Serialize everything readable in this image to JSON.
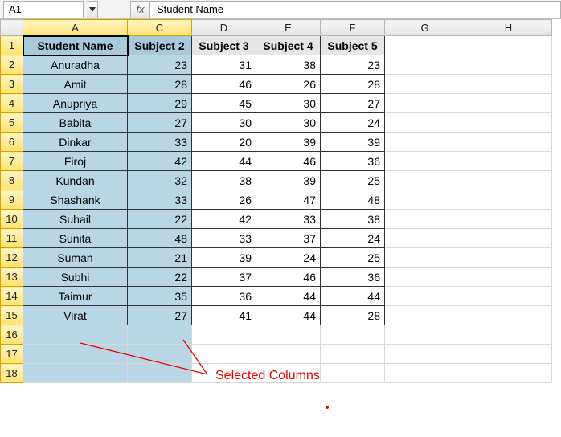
{
  "namebox": {
    "value": "A1"
  },
  "formula_bar": {
    "fx_label": "fx",
    "value": "Student Name"
  },
  "columns": [
    "A",
    "C",
    "D",
    "E",
    "F",
    "G",
    "H"
  ],
  "selected_columns": [
    "A",
    "C"
  ],
  "row_count": 18,
  "selected_row_max": 18,
  "headers": {
    "A": "Student Name",
    "C": "Subject 2",
    "D": "Subject 3",
    "E": "Subject 4",
    "F": "Subject 5"
  },
  "chart_data": {
    "type": "table",
    "title": "",
    "columns": [
      "Student Name",
      "Subject 2",
      "Subject 3",
      "Subject 4",
      "Subject 5"
    ],
    "rows": [
      [
        "Anuradha",
        23,
        31,
        38,
        23
      ],
      [
        "Amit",
        28,
        46,
        26,
        28
      ],
      [
        "Anupriya",
        29,
        45,
        30,
        27
      ],
      [
        "Babita",
        27,
        30,
        30,
        24
      ],
      [
        "Dinkar",
        33,
        20,
        39,
        39
      ],
      [
        "Firoj",
        42,
        44,
        46,
        36
      ],
      [
        "Kundan",
        32,
        38,
        39,
        25
      ],
      [
        "Shashank",
        33,
        26,
        47,
        48
      ],
      [
        "Suhail",
        22,
        42,
        33,
        38
      ],
      [
        "Sunita",
        48,
        33,
        37,
        24
      ],
      [
        "Suman",
        21,
        39,
        24,
        25
      ],
      [
        "Subhi",
        22,
        37,
        46,
        36
      ],
      [
        "Taimur",
        35,
        36,
        44,
        44
      ],
      [
        "Virat",
        27,
        41,
        44,
        28
      ]
    ]
  },
  "annotation": {
    "label": "Selected Columns"
  }
}
